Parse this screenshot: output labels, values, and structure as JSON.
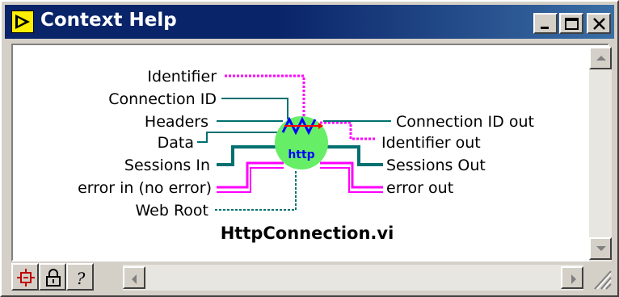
{
  "window": {
    "title": "Context Help",
    "title_icon": "labview-run-arrow-icon",
    "controls": [
      "minimize-icon",
      "maximize-icon",
      "close-icon"
    ]
  },
  "diagram": {
    "vi_name": "HttpConnection.vi",
    "vi_icon_text": "http",
    "inputs": [
      "Identifier",
      "Connection ID",
      "Headers",
      "Data",
      "Sessions In",
      "error in (no error)",
      "Web Root"
    ],
    "outputs": [
      "Connection ID out",
      "Identifier out",
      "Sessions Out",
      "error out"
    ],
    "colors": {
      "pink_wire": "#ff00ff",
      "teal_wire": "#007070",
      "vi_circle": "#66ee66",
      "vi_text": "#0000ff"
    }
  },
  "toolbar": {
    "buttons": [
      "show-connector-terminals-icon",
      "lock-icon",
      "help-question-icon"
    ]
  }
}
